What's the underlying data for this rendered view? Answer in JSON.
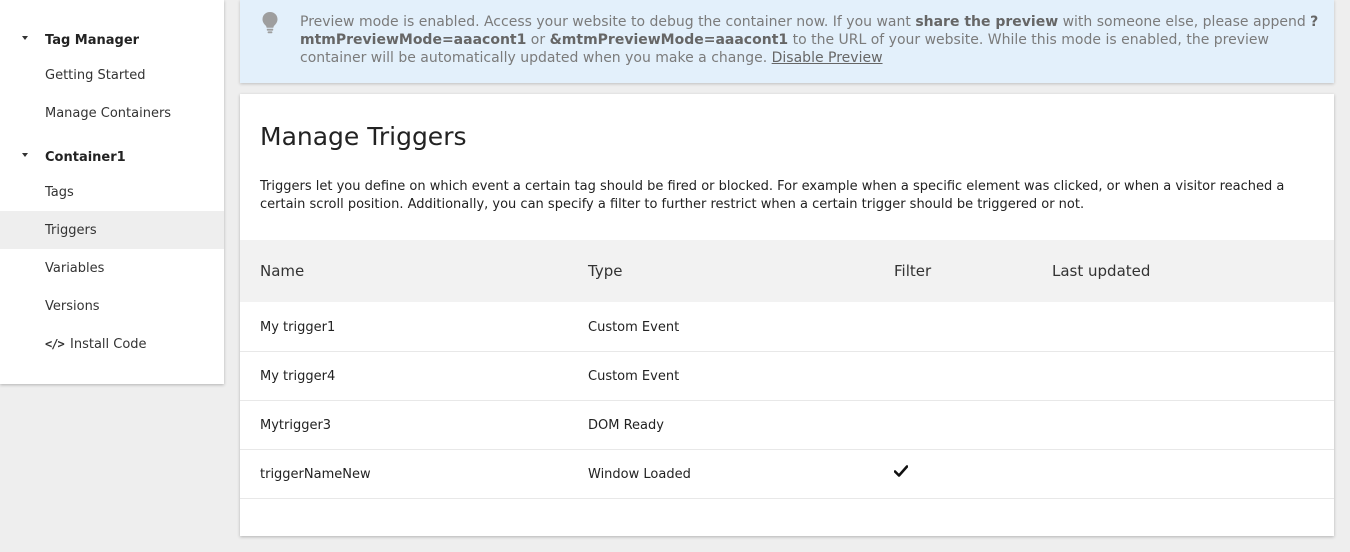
{
  "sidebar": {
    "sections": [
      {
        "title": "Tag Manager",
        "items": [
          {
            "label": "Getting Started"
          },
          {
            "label": "Manage Containers"
          }
        ]
      },
      {
        "title": "Container1",
        "items": [
          {
            "label": "Tags"
          },
          {
            "label": "Triggers",
            "active": true
          },
          {
            "label": "Variables"
          },
          {
            "label": "Versions"
          },
          {
            "label": "Install Code",
            "icon": "code-icon",
            "icon_glyph": "</>"
          }
        ]
      }
    ]
  },
  "banner": {
    "icon": "lightbulb-icon",
    "text_1": "Preview mode is enabled. Access your website to debug the container now. If you want ",
    "bold_1": "share the preview",
    "text_2": " with someone else, please append ",
    "bold_2": "?mtmPreviewMode=aaacont1",
    "text_3": " or ",
    "bold_3": "&mtmPreviewMode=aaacont1",
    "text_4": " to the URL of your website. While this mode is enabled, the preview container will be automatically updated when you make a change. ",
    "link": "Disable Preview",
    "background_color": "#e3f0fb"
  },
  "main": {
    "title": "Manage Triggers",
    "description": "Triggers let you define on which event a certain tag should be fired or blocked. For example when a specific element was clicked, or when a visitor reached a certain scroll position. Additionally, you can specify a filter to further restrict when a certain trigger should be triggered or not.",
    "table": {
      "headers": [
        "Name",
        "Type",
        "Filter",
        "Last updated"
      ],
      "rows": [
        {
          "name": "My trigger1",
          "type": "Custom Event",
          "filter": false,
          "updated": ""
        },
        {
          "name": "My trigger4",
          "type": "Custom Event",
          "filter": false,
          "updated": ""
        },
        {
          "name": "Mytrigger3",
          "type": "DOM Ready",
          "filter": false,
          "updated": ""
        },
        {
          "name": "triggerNameNew",
          "type": "Window Loaded",
          "filter": true,
          "updated": ""
        }
      ]
    }
  }
}
